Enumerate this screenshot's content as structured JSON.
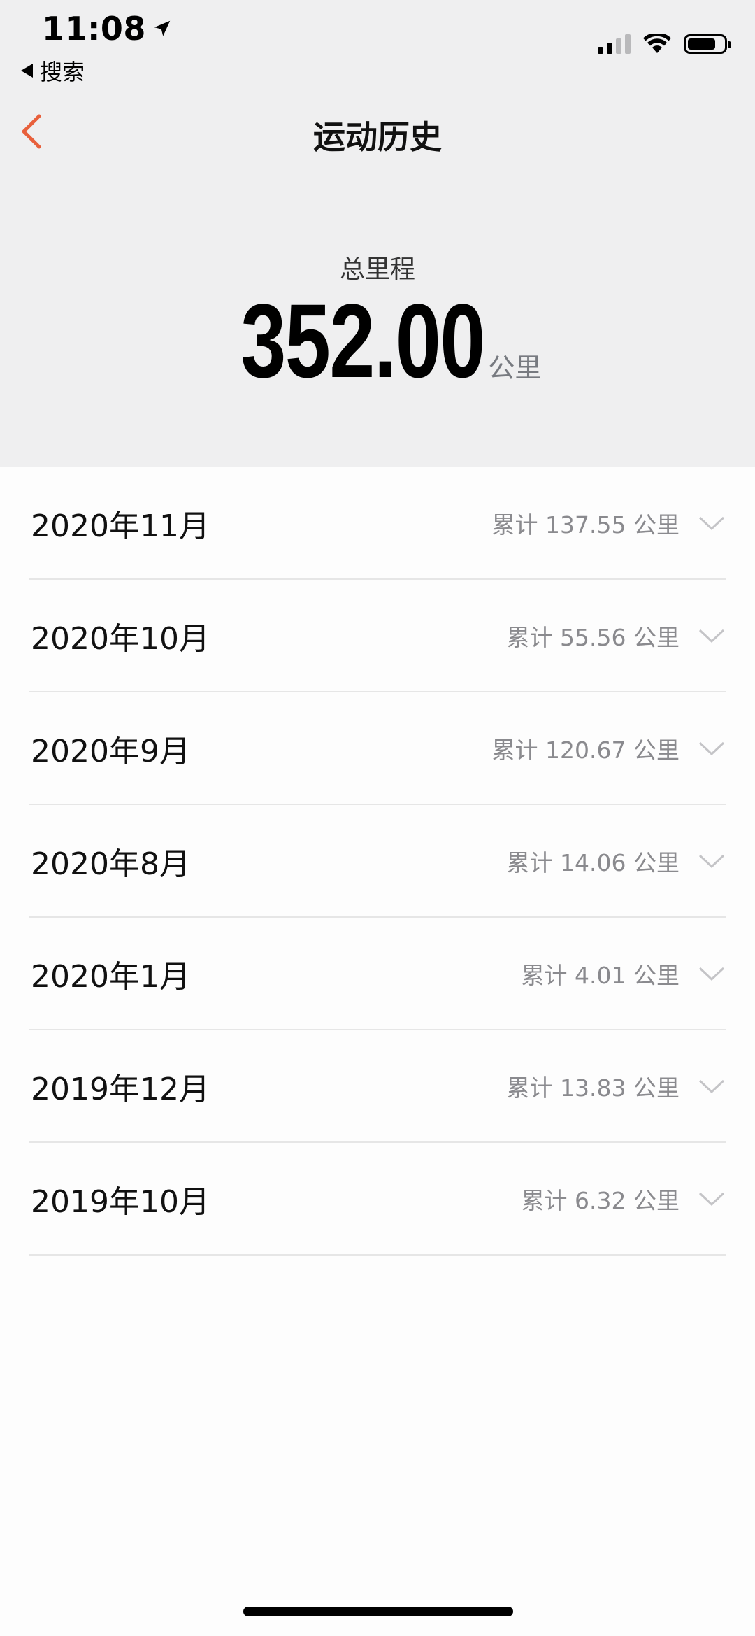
{
  "status_bar": {
    "time": "11:08",
    "back_app": "搜索"
  },
  "nav": {
    "title": "运动历史"
  },
  "summary": {
    "label": "总里程",
    "value": "352.00",
    "unit": "公里"
  },
  "months": [
    {
      "month": "2020年11月",
      "total": "累计 137.55 公里"
    },
    {
      "month": "2020年10月",
      "total": "累计 55.56 公里"
    },
    {
      "month": "2020年9月",
      "total": "累计 120.67 公里"
    },
    {
      "month": "2020年8月",
      "total": "累计 14.06 公里"
    },
    {
      "month": "2020年1月",
      "total": "累计 4.01 公里"
    },
    {
      "month": "2019年12月",
      "total": "累计 13.83 公里"
    },
    {
      "month": "2019年10月",
      "total": "累计 6.32 公里"
    }
  ],
  "colors": {
    "accent": "#e8603c",
    "header_bg": "#efeff0",
    "list_bg": "#fdfdfd",
    "secondary_text": "#8a8a8e"
  }
}
